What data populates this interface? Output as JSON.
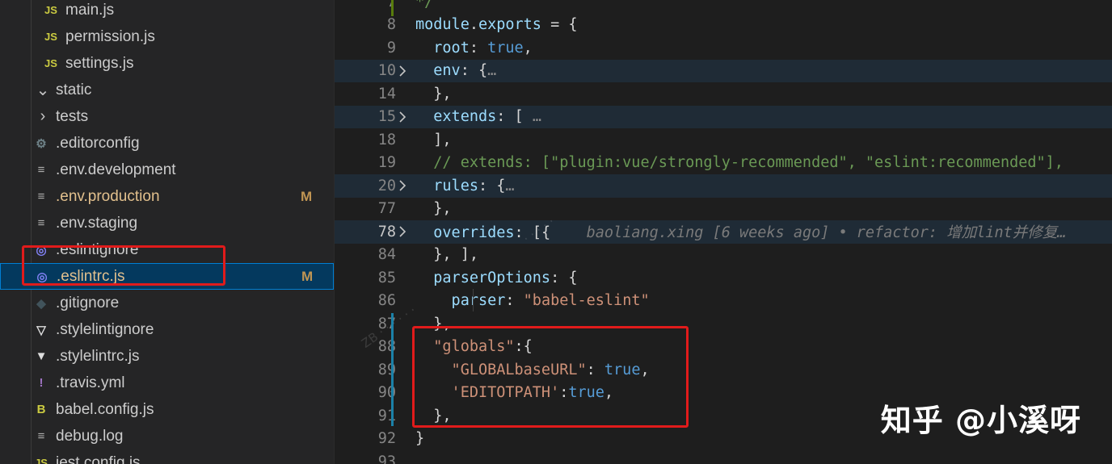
{
  "explorer": {
    "items": [
      {
        "icon": "js-icon",
        "glyph": "JS",
        "label": "main.js",
        "badge": ""
      },
      {
        "icon": "js-icon",
        "glyph": "JS",
        "label": "permission.js",
        "badge": ""
      },
      {
        "icon": "js-icon",
        "glyph": "JS",
        "label": "settings.js",
        "badge": ""
      },
      {
        "icon": "chevron-down-icon",
        "glyph": "⌄",
        "label": "static",
        "badge": ""
      },
      {
        "icon": "chevron-right-icon",
        "glyph": "›",
        "label": "tests",
        "badge": ""
      },
      {
        "icon": "gear-icon",
        "glyph": "⚙",
        "label": ".editorconfig",
        "badge": ""
      },
      {
        "icon": "lines-icon",
        "glyph": "≡",
        "label": ".env.development",
        "badge": ""
      },
      {
        "icon": "lines-icon",
        "glyph": "≡",
        "label": ".env.production",
        "badge": "M"
      },
      {
        "icon": "lines-icon",
        "glyph": "≡",
        "label": ".env.staging",
        "badge": ""
      },
      {
        "icon": "eslint-icon",
        "glyph": "◎",
        "label": ".eslintignore",
        "badge": ""
      },
      {
        "icon": "eslint-icon",
        "glyph": "◎",
        "label": ".eslintrc.js",
        "badge": "M"
      },
      {
        "icon": "git-icon",
        "glyph": "◆",
        "label": ".gitignore",
        "badge": ""
      },
      {
        "icon": "stylelint-icon",
        "glyph": "▽",
        "label": ".stylelintignore",
        "badge": ""
      },
      {
        "icon": "stylelint-icon",
        "glyph": "▼",
        "label": ".stylelintrc.js",
        "badge": ""
      },
      {
        "icon": "exclamation-icon",
        "glyph": "!",
        "label": ".travis.yml",
        "badge": ""
      },
      {
        "icon": "babel-icon",
        "glyph": "B",
        "label": "babel.config.js",
        "badge": ""
      },
      {
        "icon": "lines-icon",
        "glyph": "≡",
        "label": "debug.log",
        "badge": ""
      },
      {
        "icon": "js-icon",
        "glyph": "JS",
        "label": "jest.config.js",
        "badge": ""
      }
    ]
  },
  "editor": {
    "lines": [
      {
        "n": "7",
        "fold": false,
        "code": [
          {
            "t": "*/",
            "c": "c"
          }
        ]
      },
      {
        "n": "8",
        "fold": false,
        "code": [
          {
            "t": "module",
            "c": "k"
          },
          {
            "t": ".",
            "c": "d"
          },
          {
            "t": "exports",
            "c": "k"
          },
          {
            "t": " = {",
            "c": "d"
          }
        ]
      },
      {
        "n": "9",
        "fold": false,
        "code": [
          {
            "t": "  root",
            "c": "k"
          },
          {
            "t": ": ",
            "c": "d"
          },
          {
            "t": "true",
            "c": "b"
          },
          {
            "t": ",",
            "c": "d"
          }
        ]
      },
      {
        "n": "10",
        "fold": true,
        "code": [
          {
            "t": "  env",
            "c": "k"
          },
          {
            "t": ": {",
            "c": "d"
          },
          {
            "t": "…",
            "c": "ell"
          }
        ]
      },
      {
        "n": "14",
        "fold": false,
        "code": [
          {
            "t": "  },",
            "c": "d"
          }
        ]
      },
      {
        "n": "15",
        "fold": true,
        "code": [
          {
            "t": "  extends",
            "c": "k"
          },
          {
            "t": ": [ ",
            "c": "d"
          },
          {
            "t": "…",
            "c": "ell"
          }
        ]
      },
      {
        "n": "18",
        "fold": false,
        "code": [
          {
            "t": "  ],",
            "c": "d"
          }
        ]
      },
      {
        "n": "19",
        "fold": false,
        "code": [
          {
            "t": "  // extends: [\"plugin:vue/strongly-recommended\", \"eslint:recommended\"],",
            "c": "c"
          }
        ]
      },
      {
        "n": "20",
        "fold": true,
        "code": [
          {
            "t": "  rules",
            "c": "k"
          },
          {
            "t": ": {",
            "c": "d"
          },
          {
            "t": "…",
            "c": "ell"
          }
        ]
      },
      {
        "n": "77",
        "fold": false,
        "code": [
          {
            "t": "  },",
            "c": "d"
          }
        ]
      },
      {
        "n": "78",
        "fold": true,
        "code": [
          {
            "t": "  overrides",
            "c": "k"
          },
          {
            "t": ": [{",
            "c": "d"
          },
          {
            "t": "    baoliang.xing [6 weeks ago] • refactor: 增加lint并修复…",
            "c": "blame"
          }
        ]
      },
      {
        "n": "84",
        "fold": false,
        "code": [
          {
            "t": "  }, ],",
            "c": "d"
          }
        ]
      },
      {
        "n": "85",
        "fold": false,
        "code": [
          {
            "t": "  parserOptions",
            "c": "k"
          },
          {
            "t": ": {",
            "c": "d"
          }
        ]
      },
      {
        "n": "86",
        "fold": false,
        "code": [
          {
            "t": "    parser",
            "c": "k"
          },
          {
            "t": ": ",
            "c": "d"
          },
          {
            "t": "\"babel-eslint\"",
            "c": "s"
          }
        ]
      },
      {
        "n": "87",
        "fold": false,
        "code": [
          {
            "t": "  },",
            "c": "d"
          }
        ]
      },
      {
        "n": "88",
        "fold": false,
        "code": [
          {
            "t": "  \"globals\"",
            "c": "s"
          },
          {
            "t": ":{",
            "c": "d"
          }
        ]
      },
      {
        "n": "89",
        "fold": false,
        "code": [
          {
            "t": "    \"GLOBALbaseURL\"",
            "c": "s"
          },
          {
            "t": ": ",
            "c": "d"
          },
          {
            "t": "true",
            "c": "b"
          },
          {
            "t": ",",
            "c": "d"
          }
        ]
      },
      {
        "n": "90",
        "fold": false,
        "code": [
          {
            "t": "    'EDITOTPATH'",
            "c": "s"
          },
          {
            "t": ":",
            "c": "d"
          },
          {
            "t": "true",
            "c": "b"
          },
          {
            "t": ",",
            "c": "d"
          }
        ]
      },
      {
        "n": "91",
        "fold": false,
        "code": [
          {
            "t": "  },",
            "c": "d"
          }
        ]
      },
      {
        "n": "92",
        "fold": false,
        "code": [
          {
            "t": "}",
            "c": "d"
          }
        ]
      },
      {
        "n": "93",
        "fold": false,
        "code": []
      }
    ],
    "current_line": "78"
  },
  "watermark": {
    "text": "知乎 @小溪呀"
  },
  "colors": {
    "highlight_box": "#e11b1b",
    "selection": "#04395e",
    "modified": "#e2c08d"
  }
}
